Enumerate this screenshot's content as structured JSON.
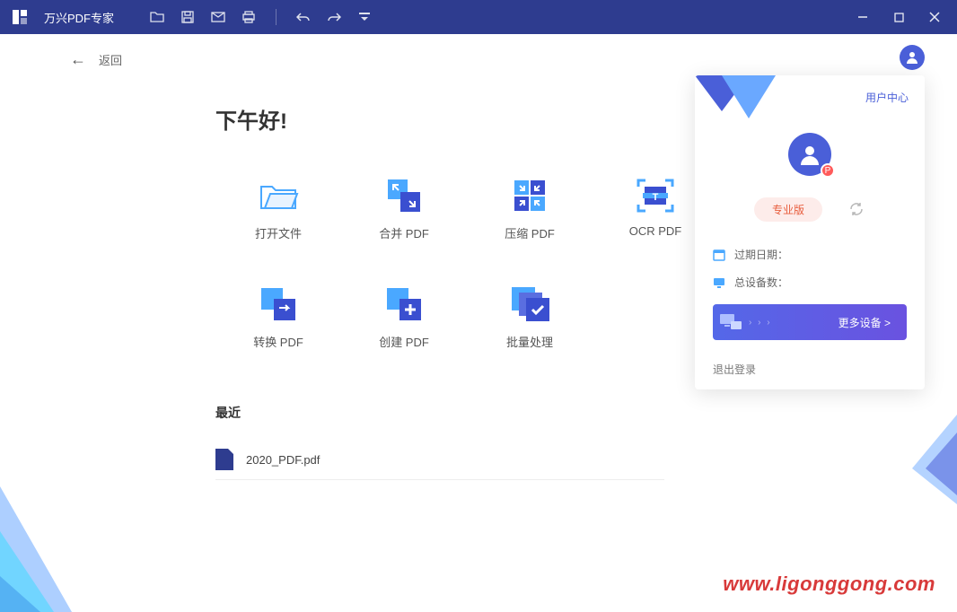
{
  "app": {
    "title": "万兴PDF专家"
  },
  "nav": {
    "back": "返回"
  },
  "greeting": "下午好!",
  "actions": {
    "open": "打开文件",
    "merge": "合并 PDF",
    "compress": "压缩 PDF",
    "ocr": "OCR PDF",
    "convert": "转换 PDF",
    "create": "创建 PDF",
    "batch": "批量处理"
  },
  "recent": {
    "title": "最近",
    "items": [
      {
        "name": "2020_PDF.pdf"
      }
    ]
  },
  "userPanel": {
    "centerLink": "用户中心",
    "plan": "专业版",
    "expiryLabel": "过期日期：",
    "deviceCountLabel": "总设备数：",
    "moreDevices": "更多设备 >",
    "logout": "退出登录",
    "avatarBadge": "P"
  },
  "watermark": "www.ligonggong.com"
}
